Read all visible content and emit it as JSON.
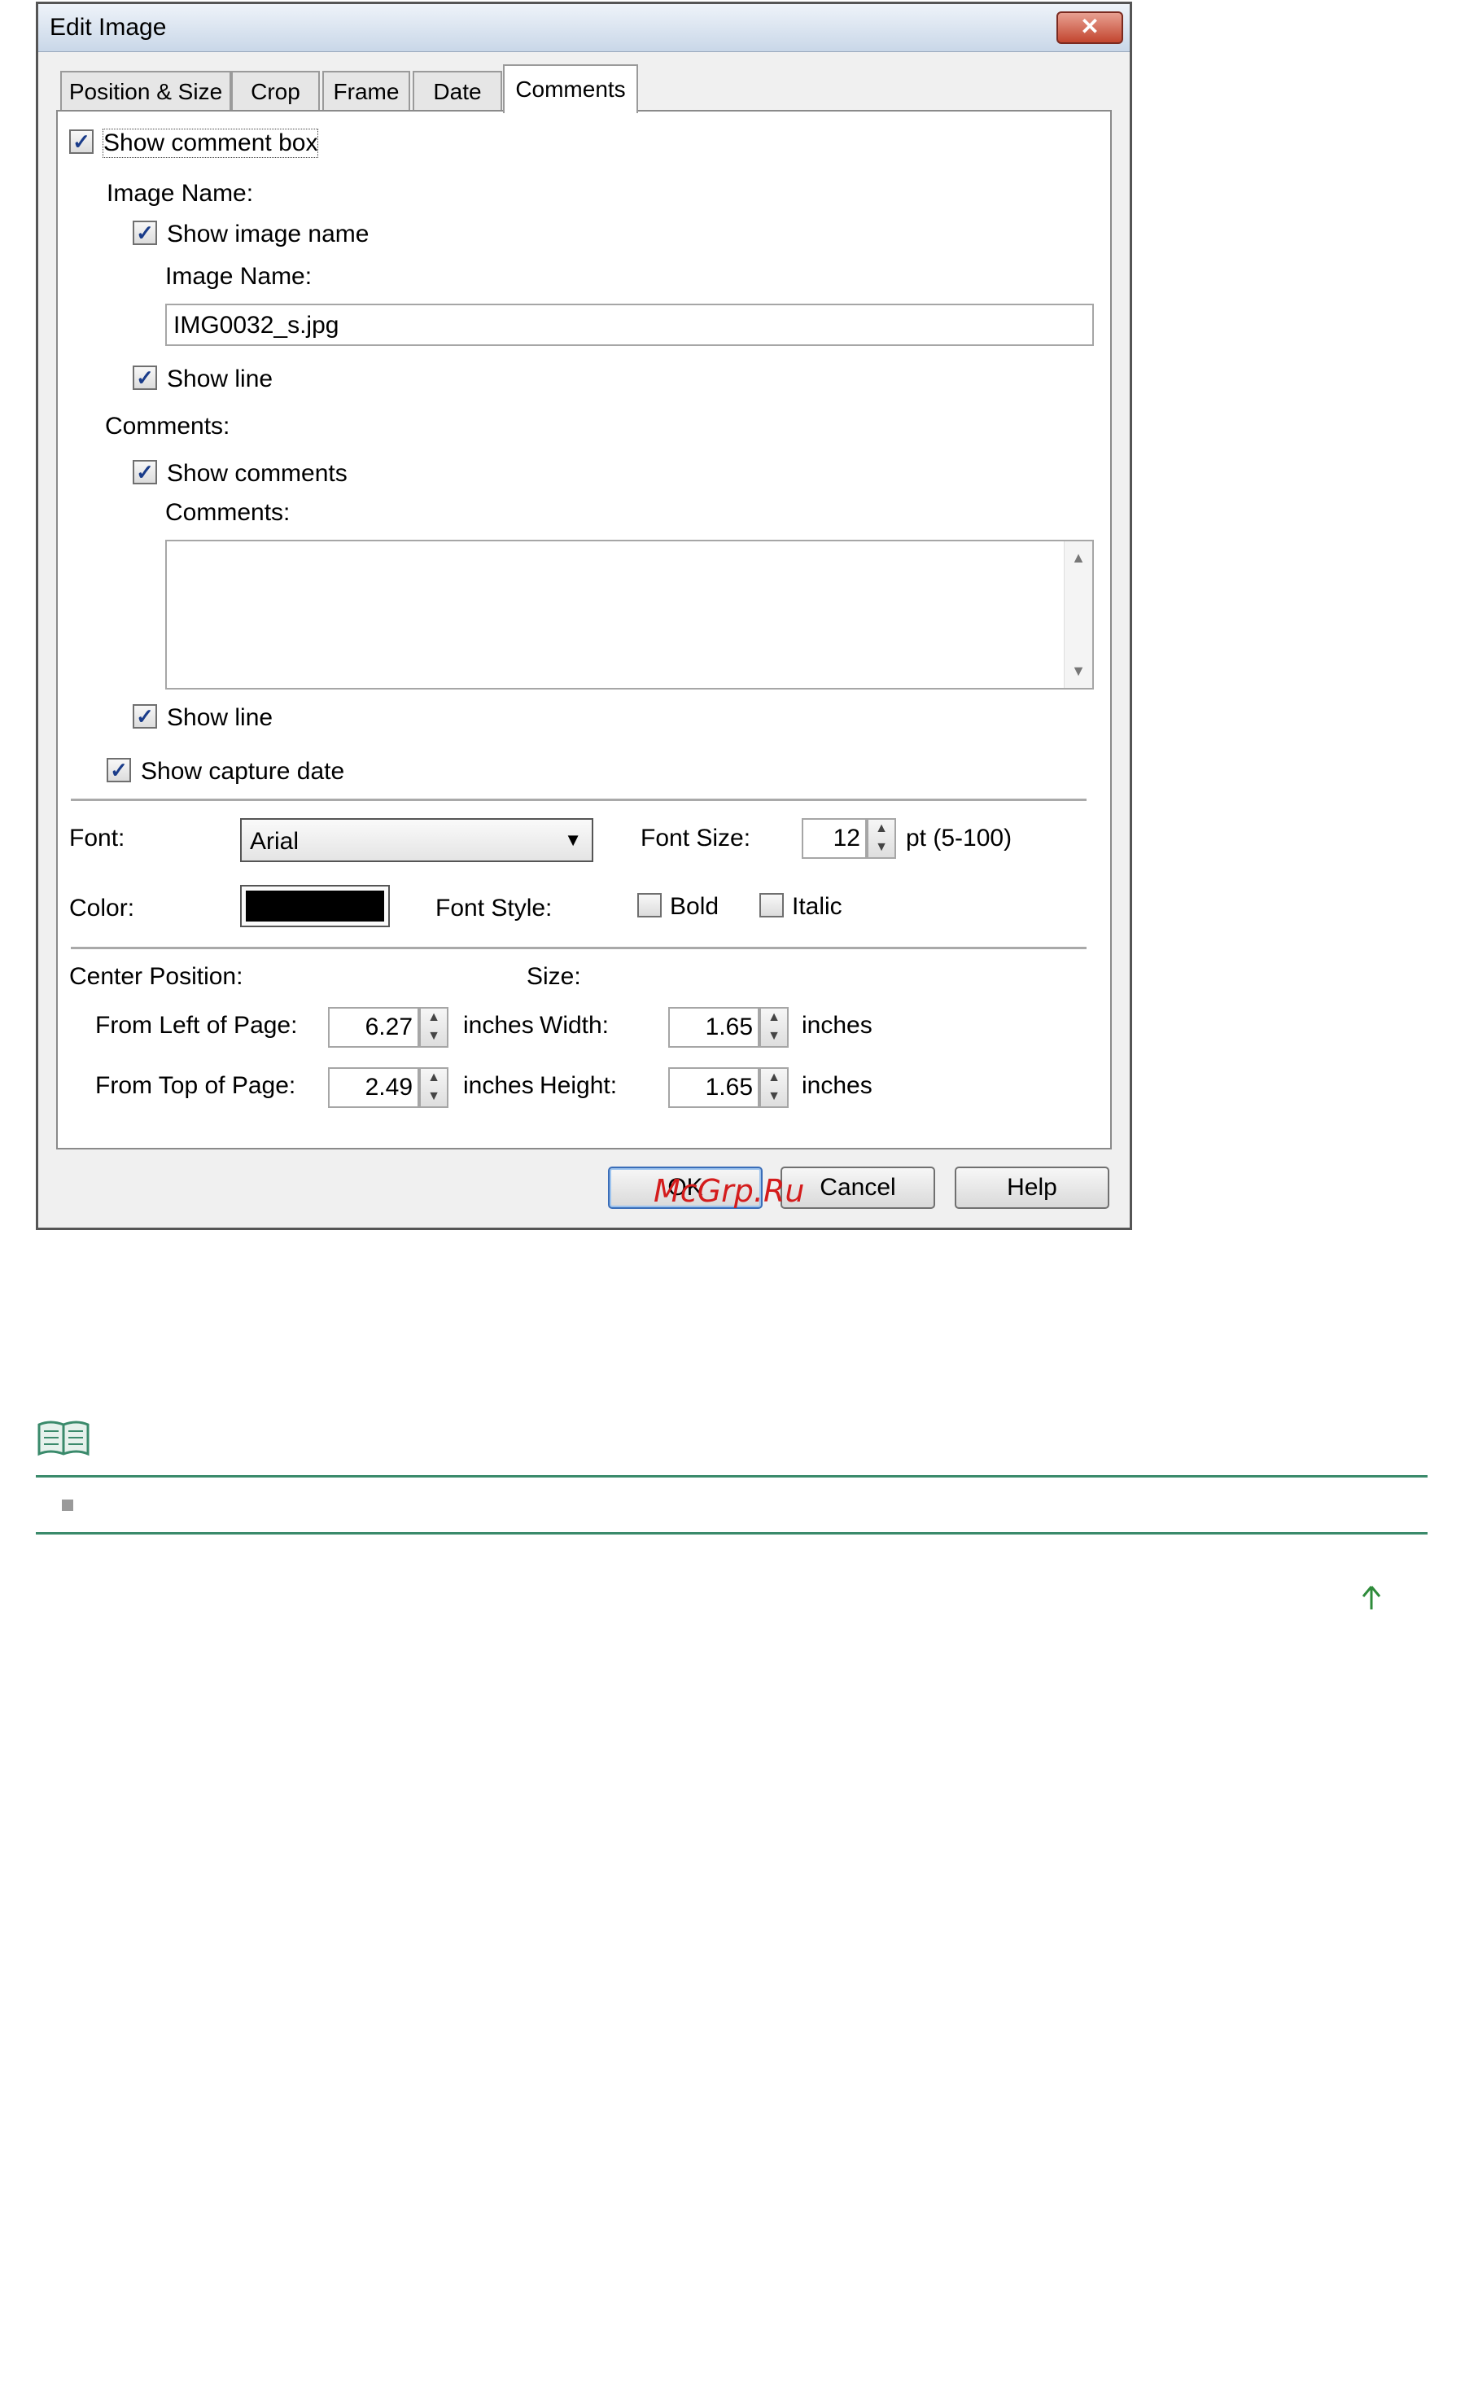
{
  "dialog": {
    "title": "Edit Image",
    "close_label": "✕",
    "tabs": [
      "Position & Size",
      "Crop",
      "Frame",
      "Date",
      "Comments"
    ],
    "active_tab": "Comments"
  },
  "comments_tab": {
    "show_comment_box": "Show comment box",
    "image_name_group": "Image Name:",
    "show_image_name": "Show image name",
    "image_name_label": "Image Name:",
    "image_name_value": "IMG0032_s.jpg",
    "show_line_1": "Show line",
    "comments_group": "Comments:",
    "show_comments": "Show comments",
    "comments_label": "Comments:",
    "comments_value": "",
    "show_line_2": "Show line",
    "show_capture_date": "Show capture date"
  },
  "font_section": {
    "font_label": "Font:",
    "font_value": "Arial",
    "font_size_label": "Font Size:",
    "font_size_value": "12",
    "font_size_range": "pt (5-100)",
    "color_label": "Color:",
    "color_value": "#000000",
    "font_style_label": "Font Style:",
    "bold_label": "Bold",
    "italic_label": "Italic"
  },
  "position_section": {
    "center_position_label": "Center Position:",
    "size_label": "Size:",
    "from_left_label": "From Left of Page:",
    "from_left_value": "6.27",
    "from_top_label": "From Top of Page:",
    "from_top_value": "2.49",
    "width_label": "Width:",
    "width_value": "1.65",
    "height_label": "Height:",
    "height_value": "1.65",
    "unit": "inches"
  },
  "buttons": {
    "ok": "OK",
    "cancel": "Cancel",
    "help": "Help"
  },
  "watermark": "McGrp.Ru",
  "colors": {
    "note_rule": "#3a8a6b",
    "accent_blue": "#3a6db8",
    "watermark": "#d41c1c"
  },
  "icons": {
    "note": "note-book-icon",
    "top": "arrow-up-icon"
  }
}
